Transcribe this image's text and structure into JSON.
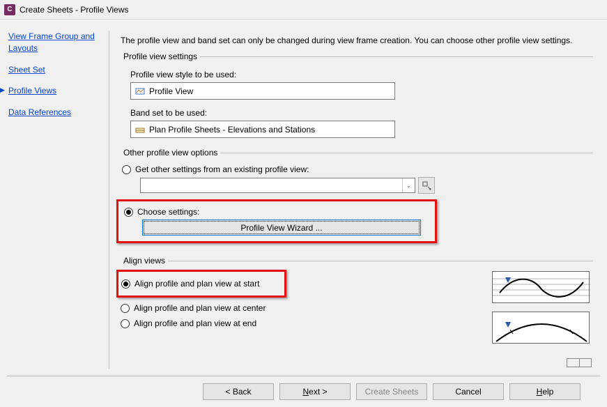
{
  "titlebar": {
    "icon_letter": "C",
    "title": "Create Sheets - Profile Views"
  },
  "sidebar": {
    "items": [
      {
        "label": "View Frame Group and Layouts",
        "active": false
      },
      {
        "label": "Sheet Set",
        "active": false
      },
      {
        "label": "Profile Views",
        "active": true
      },
      {
        "label": "Data References",
        "active": false
      }
    ]
  },
  "main": {
    "intro": "The profile view and band set can only be changed during view frame creation. You can choose other profile view settings.",
    "profile_settings": {
      "legend": "Profile view settings",
      "style_label": "Profile view style to be used:",
      "style_value": "Profile View",
      "band_label": "Band set to be used:",
      "band_value": "Plan Profile Sheets - Elevations and Stations"
    },
    "other_options": {
      "legend": "Other profile view options",
      "radio_existing": "Get other settings from an existing profile view:",
      "combo_value": "",
      "radio_choose": "Choose settings:",
      "wizard_button": "Profile View Wizard ..."
    },
    "align": {
      "legend": "Align views",
      "radio_start": "Align profile and plan view at start",
      "radio_center": "Align profile and plan view at center",
      "radio_end": "Align profile and plan view at end"
    }
  },
  "footer": {
    "back": "< Back",
    "next": "Next >",
    "create": "Create Sheets",
    "cancel": "Cancel",
    "help": "Help"
  }
}
